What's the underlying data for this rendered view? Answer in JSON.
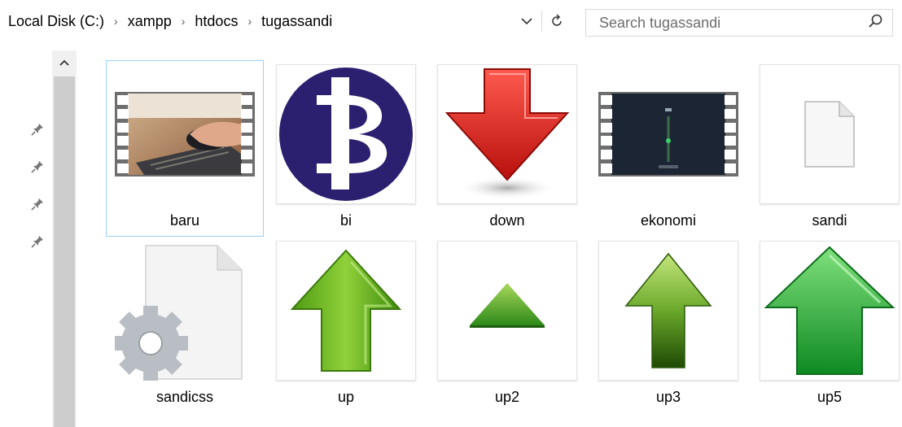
{
  "address_bar": {
    "crumbs": [
      "Local Disk (C:)",
      "xampp",
      "htdocs",
      "tugassandi"
    ],
    "separator": "›"
  },
  "search": {
    "placeholder": "Search tugassandi"
  },
  "nav": {
    "pins": 4
  },
  "items": [
    {
      "name": "baru",
      "kind": "video",
      "selected": true
    },
    {
      "name": "bi",
      "kind": "image"
    },
    {
      "name": "down",
      "kind": "image"
    },
    {
      "name": "ekonomi",
      "kind": "video"
    },
    {
      "name": "sandi",
      "kind": "blank-file"
    },
    {
      "name": "sandicss",
      "kind": "settings-file"
    },
    {
      "name": "up",
      "kind": "image"
    },
    {
      "name": "up2",
      "kind": "image"
    },
    {
      "name": "up3",
      "kind": "image"
    },
    {
      "name": "up5",
      "kind": "image"
    }
  ],
  "colors": {
    "selection_border": "#99d1ff",
    "bi_circle": "#2b1f6f",
    "down_red": "#e0201b",
    "green_arrow": "#6fbf1f"
  }
}
